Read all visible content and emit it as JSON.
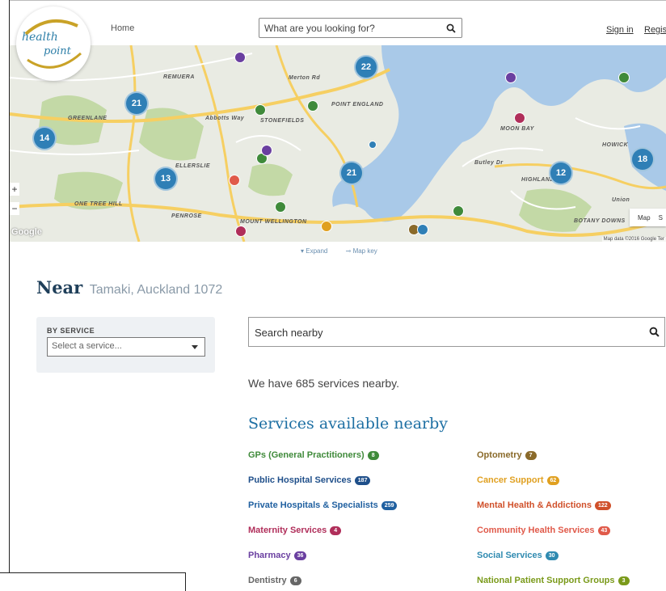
{
  "header": {
    "logo_line1": "health",
    "logo_line2": "point",
    "home_label": "Home",
    "search_placeholder": "What are you looking for?",
    "signin_label": "Sign in",
    "register_label": "Register"
  },
  "map": {
    "area_labels": [
      "REMUERA",
      "GREENLANE",
      "ELLERSLIE",
      "ONE TREE HILL",
      "PENROSE",
      "MOUNT WELLINGTON",
      "STONEFIELDS",
      "POINT ENGLAND",
      "MOON BAY",
      "HOWICK",
      "HIGHLAND",
      "BOTANY DOWNS",
      "Abbotts Way",
      "Merton Rd",
      "Butley Dr",
      "Union"
    ],
    "clusters": [
      "22",
      "21",
      "14",
      "13",
      "21",
      "12",
      "18"
    ],
    "zoom_in": "+",
    "zoom_out": "−",
    "map_type": "Map",
    "map_type_alt": "S",
    "google_label": "Google",
    "attribution": "Map data ©2016 Google  Ter"
  },
  "expand": {
    "expand_label": "Expand",
    "mapkey_label": "Map key"
  },
  "near": {
    "heading": "Near",
    "location": "Tamaki, Auckland 1072"
  },
  "filter": {
    "title": "BY SERVICE",
    "placeholder": "Select a service..."
  },
  "search_nearby": {
    "placeholder": "Search nearby"
  },
  "summary": {
    "count_text": "We have 685 services nearby."
  },
  "services": {
    "heading": "Services available nearby",
    "left": [
      {
        "label": "GPs (General Practitioners)",
        "count": "8",
        "color": "#3f8a3a"
      },
      {
        "label": "Public Hospital Services",
        "count": "187",
        "color": "#1f4f8a"
      },
      {
        "label": "Private Hospitals & Specialists",
        "count": "259",
        "color": "#2060a0"
      },
      {
        "label": "Maternity Services",
        "count": "4",
        "color": "#b02e5a"
      },
      {
        "label": "Pharmacy",
        "count": "36",
        "color": "#6a3fa0"
      },
      {
        "label": "Dentistry",
        "count": "6",
        "color": "#666666"
      }
    ],
    "right": [
      {
        "label": "Optometry",
        "count": "7",
        "color": "#8a6a2a"
      },
      {
        "label": "Cancer Support",
        "count": "62",
        "color": "#e0a020"
      },
      {
        "label": "Mental Health & Addictions",
        "count": "122",
        "color": "#d0502a"
      },
      {
        "label": "Community Health Services",
        "count": "43",
        "color": "#e05a4a"
      },
      {
        "label": "Social Services",
        "count": "30",
        "color": "#2f8ab0"
      },
      {
        "label": "National Patient Support Groups",
        "count": "3",
        "color": "#7a9a1a"
      }
    ]
  },
  "colors": {
    "cluster": "#2f7fb6",
    "water": "#a9c9e8",
    "park": "#c3d9a6",
    "road_major": "#f6cf62"
  }
}
